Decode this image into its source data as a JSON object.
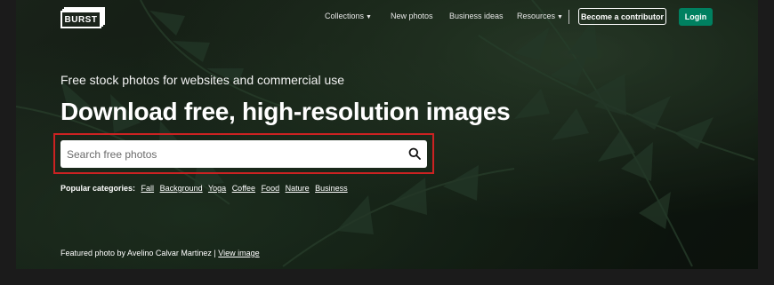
{
  "logo": {
    "text": "BURST"
  },
  "nav": {
    "collections": "Collections",
    "new_photos": "New photos",
    "business_ideas": "Business ideas",
    "resources": "Resources",
    "become_contributor": "Become a contributor",
    "login": "Login"
  },
  "hero": {
    "subtitle": "Free stock photos for websites and commercial use",
    "title": "Download free, high-resolution images"
  },
  "search": {
    "placeholder": "Search free photos"
  },
  "popular": {
    "label": "Popular categories:",
    "categories": [
      "Fall",
      "Background",
      "Yoga",
      "Coffee",
      "Food",
      "Nature",
      "Business"
    ]
  },
  "featured": {
    "text": "Featured photo by Avelino Calvar Martinez |",
    "link": "View image"
  },
  "colors": {
    "login_green": "#008060",
    "highlight_red": "#cc2222",
    "background": "#1b1b1b"
  }
}
